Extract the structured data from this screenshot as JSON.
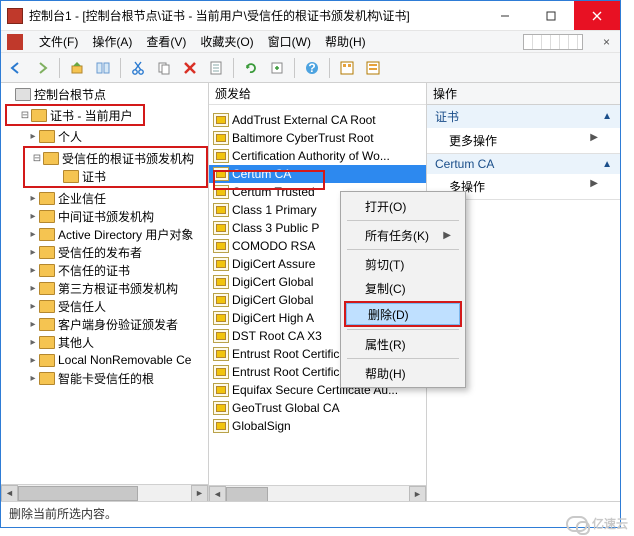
{
  "title": "控制台1 - [控制台根节点\\证书 - 当前用户\\受信任的根证书颁发机构\\证书]",
  "menu": {
    "file": "文件(F)",
    "action": "操作(A)",
    "view": "查看(V)",
    "favorites": "收藏夹(O)",
    "window": "窗口(W)",
    "help": "帮助(H)"
  },
  "status": "删除当前所选内容。",
  "tree": {
    "root": "控制台根节点",
    "certs_user": "证书 - 当前用户",
    "items": [
      {
        "label": "个人"
      },
      {
        "label": "受信任的根证书颁发机构",
        "children": [
          {
            "label": "证书"
          }
        ]
      },
      {
        "label": "企业信任"
      },
      {
        "label": "中间证书颁发机构"
      },
      {
        "label": "Active Directory 用户对象"
      },
      {
        "label": "受信任的发布者"
      },
      {
        "label": "不信任的证书"
      },
      {
        "label": "第三方根证书颁发机构"
      },
      {
        "label": "受信任人"
      },
      {
        "label": "客户端身份验证颁发者"
      },
      {
        "label": "其他人"
      },
      {
        "label": "Local NonRemovable Ce"
      },
      {
        "label": "智能卡受信任的根"
      }
    ]
  },
  "list": {
    "header": "颁发给",
    "items": [
      "AddTrust External CA Root",
      "Baltimore CyberTrust Root",
      "Certification Authority of Wo...",
      "Certum CA",
      "Certum Trusted",
      "Class 1 Primary",
      "Class 3 Public P",
      "COMODO RSA",
      "DigiCert Assure",
      "DigiCert Global",
      "DigiCert Global",
      "DigiCert High A",
      "DST Root CA X3",
      "Entrust Root Certification Au...",
      "Entrust Root Certification Au...",
      "Equifax Secure Certificate Au...",
      "GeoTrust Global CA",
      "GlobalSign"
    ],
    "selected_index": 3
  },
  "context_menu": {
    "open": "打开(O)",
    "all_tasks": "所有任务(K)",
    "cut": "剪切(T)",
    "copy": "复制(C)",
    "delete": "删除(D)",
    "properties": "属性(R)",
    "help": "帮助(H)"
  },
  "actions": {
    "header": "操作",
    "sec1": "证书",
    "more1": "更多操作",
    "sec2": "Certum CA",
    "more2": "多操作"
  },
  "watermark": "亿速云"
}
